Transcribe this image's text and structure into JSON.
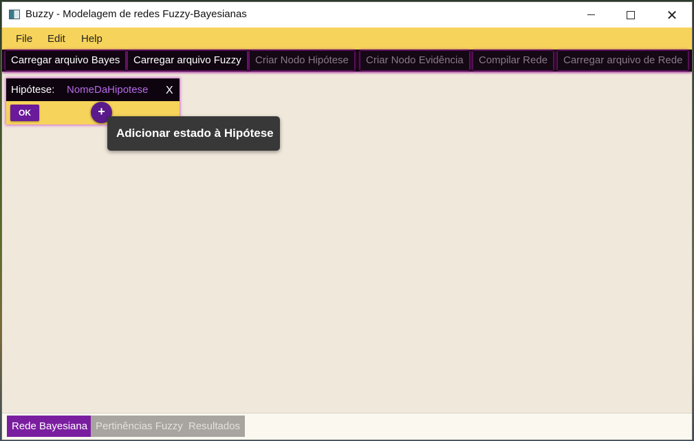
{
  "window": {
    "title": "Buzzy - Modelagem de redes Fuzzy-Bayesianas",
    "minimize_glyph": "",
    "maximize_glyph": "",
    "close_glyph": "✕"
  },
  "menu": {
    "items": [
      {
        "label": "File"
      },
      {
        "label": "Edit"
      },
      {
        "label": "Help"
      }
    ]
  },
  "toolbar": {
    "buttons": [
      {
        "label": "Carregar arquivo Bayes",
        "enabled": true
      },
      {
        "label": "Carregar arquivo Fuzzy",
        "enabled": true
      },
      {
        "label": "Criar Nodo Hipótese",
        "enabled": false
      },
      {
        "label": "Criar Nodo Evidência",
        "enabled": false
      },
      {
        "label": "Compilar Rede",
        "enabled": false
      },
      {
        "label": "Carregar arquivo de Rede",
        "enabled": false
      }
    ]
  },
  "hypothesis_node": {
    "label": "Hipótese:",
    "name_value": "NomeDaHipotese",
    "close_label": "X",
    "ok_label": "OK",
    "add_label": "+"
  },
  "tooltip": {
    "text": "Adicionar estado à Hipótese"
  },
  "tabs": [
    {
      "label": "Rede Bayesiana",
      "active": true
    },
    {
      "label": "Pertinências Fuzzy",
      "active": false
    },
    {
      "label": "Resultados",
      "active": false
    }
  ],
  "colors": {
    "menu_bg": "#f6d35a",
    "toolbar_bg": "#0b0208",
    "accent_purple": "#7a1ea0",
    "canvas_bg": "#f0e8db",
    "hypothesis_name": "#b86ae8"
  }
}
